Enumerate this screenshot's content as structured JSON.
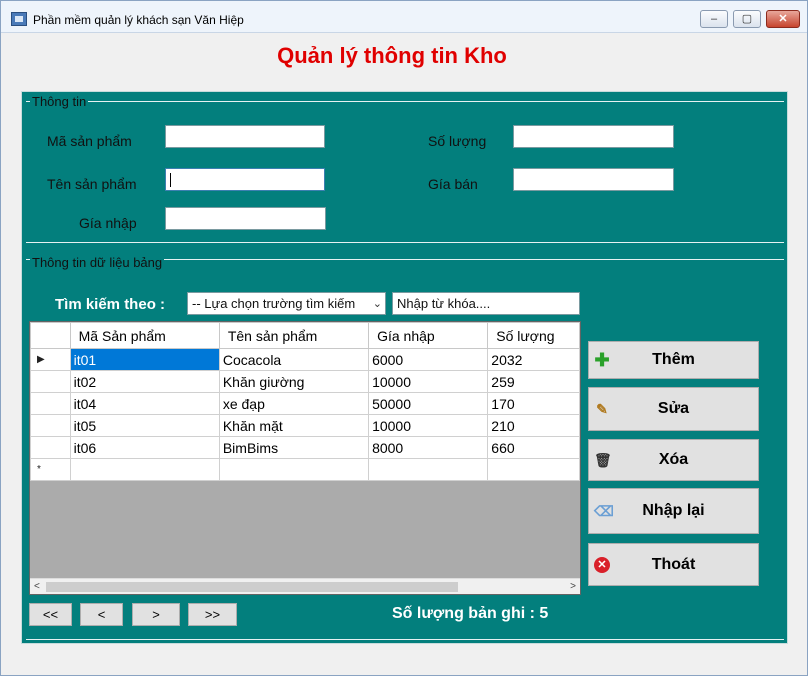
{
  "window": {
    "title": "Phần mềm quản lý khách sạn Văn Hiệp",
    "min": "–",
    "max": "▢",
    "close": "✕"
  },
  "page_title": "Quản lý thông tin Kho",
  "info_group": {
    "label": "Thông tin",
    "fields": {
      "ma_sp": {
        "label": "Mã sản phẩm",
        "value": ""
      },
      "ten_sp": {
        "label": "Tên sản phẩm",
        "value": ""
      },
      "gia_nhap": {
        "label": "Gía nhập",
        "value": ""
      },
      "so_luong": {
        "label": "Số lượng",
        "value": ""
      },
      "gia_ban": {
        "label": "Gía bán",
        "value": ""
      }
    }
  },
  "data_group": {
    "label": "Thông tin dữ liệu  bảng",
    "search_label": "Tìm kiếm theo :",
    "search_field": "-- Lựa chọn trường tìm kiếm",
    "keyword": "Nhập từ khóa....",
    "columns": [
      "Mã Sản phẩm",
      "Tên sản phẩm",
      "Gía nhập",
      "Số lượng"
    ],
    "rows": [
      [
        "it01",
        "Cocacola",
        "6000",
        "2032"
      ],
      [
        "it02",
        "Khăn giường",
        "10000",
        "259"
      ],
      [
        "it04",
        "xe đạp",
        "50000",
        "170"
      ],
      [
        "it05",
        "Khăn mặt",
        "10000",
        "210"
      ],
      [
        "it06",
        "BimBims",
        "8000",
        "660"
      ]
    ],
    "current_row_marker": "▶",
    "new_row_marker": "*"
  },
  "actions": {
    "add": "Thêm",
    "edit": "Sửa",
    "delete": "Xóa",
    "reset": "Nhập lại",
    "exit": "Thoát"
  },
  "pager": {
    "first": "<<",
    "prev": "<",
    "next": ">",
    "last": ">>"
  },
  "record_count": "Số lượng bản ghi : 5",
  "colors": {
    "panel": "#037f7d",
    "title": "#e00000",
    "selection": "#0078d7"
  }
}
